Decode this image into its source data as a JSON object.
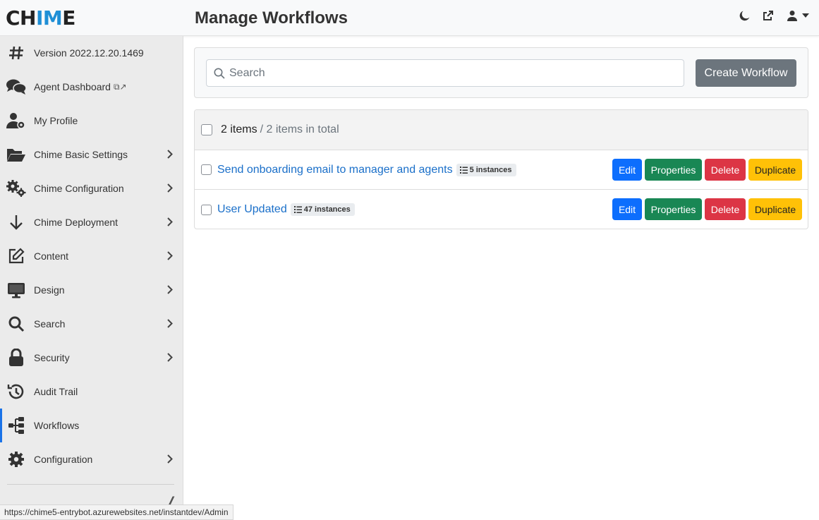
{
  "header": {
    "logo": {
      "pre": "CH",
      "accent": "IM",
      "post": "E"
    },
    "title": "Manage Workflows"
  },
  "sidebar": {
    "items": [
      {
        "label": "Version 2022.12.20.1469",
        "icon": "hash-icon"
      },
      {
        "label": "Agent Dashboard",
        "icon": "chat-bubbles-icon",
        "suffix": "⧉↗"
      },
      {
        "label": "My Profile",
        "icon": "user-gear-icon"
      },
      {
        "label": "Chime Basic Settings",
        "icon": "folder-open-icon"
      },
      {
        "label": "Chime Configuration",
        "icon": "gears-icon"
      },
      {
        "label": "Chime Deployment",
        "icon": "arrow-down-icon"
      },
      {
        "label": "Content",
        "icon": "edit-icon"
      },
      {
        "label": "Design",
        "icon": "monitor-icon"
      },
      {
        "label": "Search",
        "icon": "magnifier-icon"
      },
      {
        "label": "Security",
        "icon": "lock-icon"
      },
      {
        "label": "Audit Trail",
        "icon": "history-icon"
      },
      {
        "label": "Workflows",
        "icon": "sitemap-icon"
      },
      {
        "label": "Configuration",
        "icon": "gear-icon"
      }
    ]
  },
  "search": {
    "placeholder": "Search",
    "value": ""
  },
  "toolbar": {
    "create_label": "Create Workflow"
  },
  "list": {
    "count_label": "2 items",
    "total_label": "/ 2 items in total",
    "rows": [
      {
        "title": "Send onboarding email to manager and agents",
        "instances": "5 instances"
      },
      {
        "title": "User Updated",
        "instances": "47 instances"
      }
    ],
    "actions": {
      "edit": "Edit",
      "properties": "Properties",
      "delete": "Delete",
      "duplicate": "Duplicate"
    }
  },
  "status_bar": {
    "url": "https://chime5-entrybot.azurewebsites.net/instantdev/Admin"
  },
  "colors": {
    "accent": "#1a73e8",
    "edit": "#0d6efd",
    "properties": "#198754",
    "delete": "#dc3545",
    "duplicate": "#ffc107",
    "create": "#6c757d"
  }
}
